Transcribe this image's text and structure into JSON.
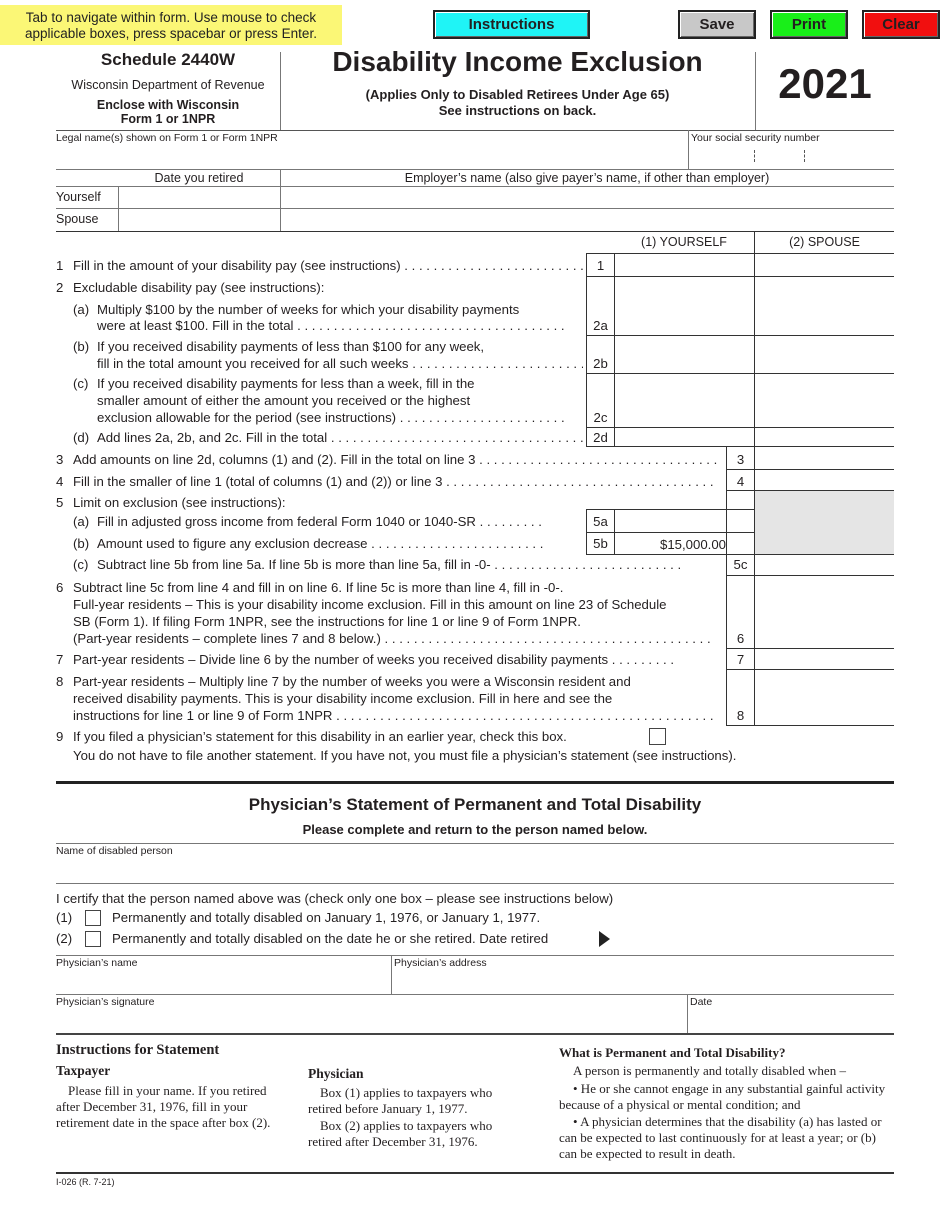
{
  "toolbar": {
    "hint": "Tab to navigate within form. Use mouse to check applicable boxes, press spacebar or press Enter.",
    "instructions_label": "Instructions",
    "save_label": "Save",
    "print_label": "Print",
    "clear_label": "Clear"
  },
  "header": {
    "schedule": "Schedule 2440W",
    "department": "Wisconsin Department of Revenue",
    "enclose_1": "Enclose with Wisconsin",
    "enclose_2": "Form 1 or 1NPR",
    "title": "Disability Income Exclusion",
    "subtitle_1": "(Applies Only to Disabled Retirees Under Age 65)",
    "subtitle_2": "See instructions on back.",
    "year": "2021"
  },
  "identity": {
    "name_label": "Legal name(s) shown on Form 1 or Form 1NPR",
    "name_value": "",
    "ssn_label": "Your social security number",
    "ssn_value": ""
  },
  "retire_table": {
    "col_date": "Date you retired",
    "col_employer": "Employer’s name (also give payer’s name, if other than employer)",
    "rows": [
      {
        "label": "Yourself",
        "date": "",
        "employer": ""
      },
      {
        "label": "Spouse",
        "date": "",
        "employer": ""
      }
    ]
  },
  "columns": {
    "col1": "(1) YOURSELF",
    "col2": "(2) SPOUSE"
  },
  "lines": {
    "l1": {
      "n": "1",
      "text": "Fill in the amount of your disability pay (see instructions)",
      "box": "1",
      "yourself": "",
      "spouse": ""
    },
    "l2": {
      "n": "2",
      "text": "Excludable disability pay (see instructions):"
    },
    "l2a": {
      "n": "(a)",
      "text1": "Multiply $100 by the number of weeks for which your disability payments",
      "text2": "were at least $100. Fill in the total",
      "box": "2a",
      "yourself": "",
      "spouse": ""
    },
    "l2b": {
      "n": "(b)",
      "text1": "If you received disability payments of less than $100 for any week,",
      "text2": "fill in the total amount you received for all such weeks",
      "box": "2b",
      "yourself": "",
      "spouse": ""
    },
    "l2c": {
      "n": "(c)",
      "text1": "If you received disability payments for less than a week, fill in the",
      "text2": "smaller amount of either the amount you received or the highest",
      "text3": "exclusion allowable for the period (see instructions)",
      "box": "2c",
      "yourself": "",
      "spouse": ""
    },
    "l2d": {
      "n": "(d)",
      "text": "Add lines 2a, 2b, and 2c. Fill in the total",
      "box": "2d",
      "yourself": "",
      "spouse": ""
    },
    "l3": {
      "n": "3",
      "text": "Add amounts on line 2d, columns (1) and (2). Fill in the total on line 3",
      "box": "3",
      "value": ""
    },
    "l4": {
      "n": "4",
      "text": "Fill in the smaller of line 1 (total of columns (1) and (2)) or line 3",
      "box": "4",
      "value": ""
    },
    "l5": {
      "n": "5",
      "text": "Limit on exclusion (see instructions):"
    },
    "l5a": {
      "n": "(a)",
      "text": "Fill in adjusted gross income from federal Form 1040 or 1040-SR",
      "box": "5a",
      "value": ""
    },
    "l5b": {
      "n": "(b)",
      "text": "Amount used to figure any exclusion decrease",
      "box": "5b",
      "value": "$15,000.00"
    },
    "l5c": {
      "n": "(c)",
      "text": "Subtract line 5b from line 5a. If line 5b is more than line 5a, fill in -0-",
      "box": "5c",
      "value": ""
    },
    "l6": {
      "n": "6",
      "text1": "Subtract line 5c from line 4 and fill in on line 6. If line 5c is more than line 4, fill in -0-.",
      "text2": "Full-year residents – This is your disability income exclusion. Fill in this amount on line 23 of Schedule",
      "text3": "SB (Form 1).  If filing Form 1NPR, see the instructions for line 1 or line 9 of Form 1NPR.",
      "text4": "(Part-year residents – complete lines 7 and 8 below.)",
      "box": "6",
      "value": ""
    },
    "l7": {
      "n": "7",
      "text": "Part-year residents – Divide line 6 by the number of weeks you received disability payments",
      "box": "7",
      "value": ""
    },
    "l8": {
      "n": "8",
      "text1": "Part-year residents – Multiply line 7 by the number of weeks you were a Wisconsin resident and",
      "text2": "received disability payments. This is your disability income exclusion. Fill in here and see the",
      "text3": "instructions for line 1 or line 9 of Form 1NPR",
      "box": "8",
      "value": ""
    },
    "l9": {
      "n": "9",
      "text1": "If you filed a physician’s statement for this disability in an earlier year, check this box.",
      "text2": "You do not have to file another statement. If you have not, you must file a physician’s statement (see instructions).",
      "checked": false
    }
  },
  "physician": {
    "title": "Physician’s Statement of Permanent and Total Disability",
    "subtitle": "Please complete and return to the person named below.",
    "name_label": "Name of disabled person",
    "certify": "I certify that the person named above was (check only one box – please see instructions below)",
    "opt1_n": "(1)",
    "opt1": "Permanently and totally disabled on January 1, 1976, or January 1, 1977.",
    "opt2_n": "(2)",
    "opt2": "Permanently and totally disabled on the date he or she retired.  Date retired",
    "phys_name_label": "Physician’s name",
    "phys_address_label": "Physician’s address",
    "phys_signature_label": "Physician’s signature",
    "date_label": "Date"
  },
  "instructions": {
    "heading": "Instructions for Statement",
    "taxpayer_heading": "Taxpayer",
    "taxpayer_text": "Please fill in your name. If you retired after December 31, 1976, fill in your retirement date in the space after box (2).",
    "physician_heading": "Physician",
    "physician_text1": "Box (1) applies to taxpayers who retired before January 1, 1977.",
    "physician_text2": "Box (2) applies to taxpayers who retired after December 31, 1976.",
    "ptd_heading": "What is Permanent and Total Disability?",
    "ptd_intro": "A person is permanently and totally disabled when –",
    "ptd_b1": "• He or she cannot engage in any substantial gainful activity because of a physical or mental condition; and",
    "ptd_b2": "• A physician determines that the disability (a) has lasted or can be expected to last continuously for at least a year; or (b) can be expected to result in death."
  },
  "footer": {
    "form_id": "I-026 (R. 7-21)"
  }
}
